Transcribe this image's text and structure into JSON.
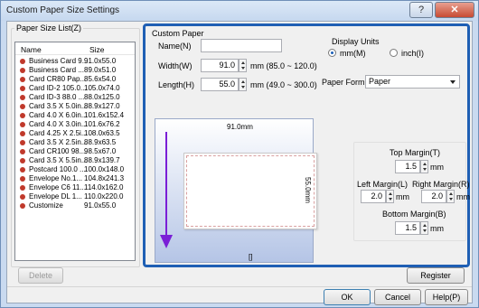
{
  "window": {
    "title": "Custom Paper Size Settings",
    "help_glyph": "?",
    "close_glyph": "✕"
  },
  "paper_list": {
    "group_label": "Paper Size List(Z)",
    "col_name": "Name",
    "col_size": "Size",
    "items": [
      {
        "name": "Business Card 9...",
        "size": "91.0x55.0"
      },
      {
        "name": "Business Card ...",
        "size": "89.0x51.0"
      },
      {
        "name": "Card CR80 Pap...",
        "size": "85.6x54.0"
      },
      {
        "name": "Card ID-2 105.0...",
        "size": "105.0x74.0"
      },
      {
        "name": "Card ID-3 88.0 ...",
        "size": "88.0x125.0"
      },
      {
        "name": "Card 3.5 X 5.0in...",
        "size": "88.9x127.0"
      },
      {
        "name": "Card 4.0 X 6.0in...",
        "size": "101.6x152.4"
      },
      {
        "name": "Card 4.0 X 3.0in...",
        "size": "101.6x76.2"
      },
      {
        "name": "Card 4.25 X 2.5i...",
        "size": "108.0x63.5"
      },
      {
        "name": "Card 3.5 X 2.5in...",
        "size": "88.9x63.5"
      },
      {
        "name": "Card CR100 98....",
        "size": "98.5x67.0"
      },
      {
        "name": "Card 3.5 X 5.5in...",
        "size": "88.9x139.7"
      },
      {
        "name": "Postcard 100.0 ...",
        "size": "100.0x148.0"
      },
      {
        "name": "Envelope No.1...",
        "size": "104.8x241.3"
      },
      {
        "name": "Envelope C6 11...",
        "size": "114.0x162.0"
      },
      {
        "name": "Envelope DL 1...",
        "size": "110.0x220.0"
      },
      {
        "name": "Customize",
        "size": "91.0x55.0"
      }
    ]
  },
  "custom_paper": {
    "group_label": "Custom Paper",
    "name_label": "Name(N)",
    "name_value": "",
    "width_label": "Width(W)",
    "width_value": "91.0",
    "width_range": "mm (85.0 ~ 120.0)",
    "length_label": "Length(H)",
    "length_value": "55.0",
    "length_range": "mm (49.0 ~ 300.0)"
  },
  "display_units": {
    "group_label": "Display Units",
    "mm_label": "mm(M)",
    "inch_label": "inch(I)",
    "selected": "mm"
  },
  "paper_form": {
    "label": "Paper Form(O)",
    "value": "Paper"
  },
  "preview": {
    "width_text": "91.0mm",
    "height_text": "55.0mm",
    "bottom_mark": "[]"
  },
  "margins": {
    "top_label": "Top Margin(T)",
    "top_value": "1.5",
    "left_label": "Left Margin(L)",
    "left_value": "2.0",
    "right_label": "Right Margin(R)",
    "right_value": "2.0",
    "bottom_label": "Bottom Margin(B)",
    "bottom_value": "1.5",
    "unit": "mm"
  },
  "buttons": {
    "delete": "Delete",
    "register": "Register",
    "ok": "OK",
    "cancel": "Cancel",
    "help": "Help(P)"
  },
  "colors": {
    "highlight_border": "#1f5fb4",
    "feed_arrow": "#7a1fd6"
  }
}
